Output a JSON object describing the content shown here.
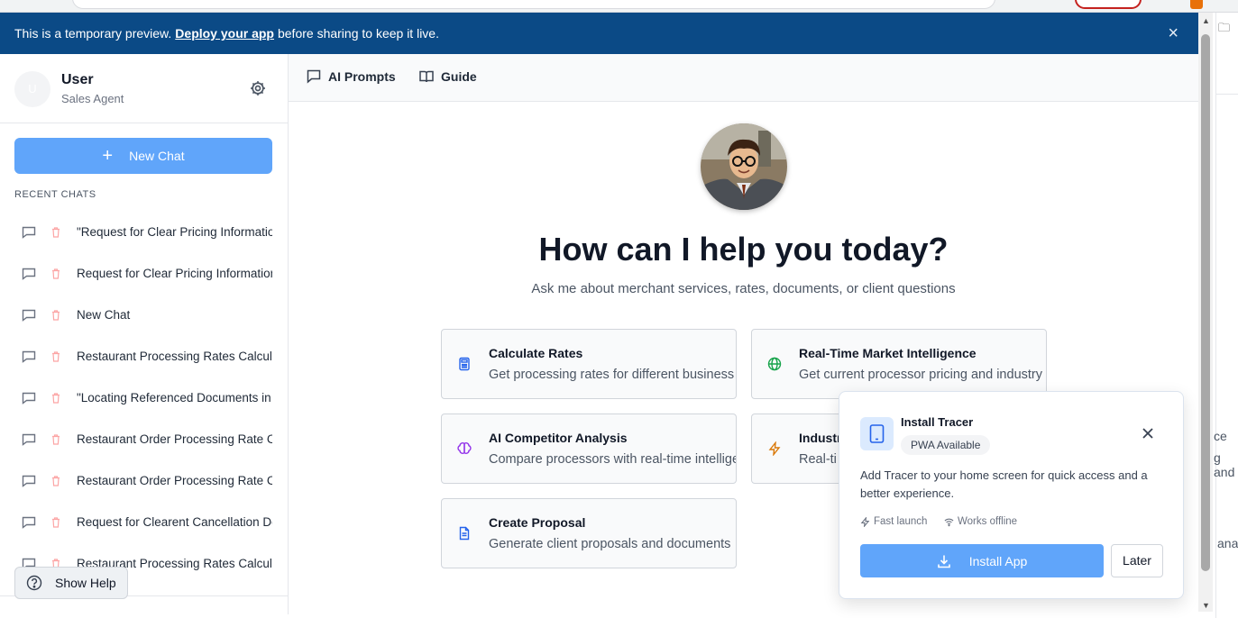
{
  "banner": {
    "text_before": "This is a temporary preview.",
    "link": "Deploy your app",
    "text_after": "before sharing to keep it live.",
    "close_icon": "close-icon"
  },
  "profile": {
    "avatar_initial": "U",
    "name": "User",
    "role": "Sales Agent",
    "settings_icon": "gear-icon"
  },
  "sidebar": {
    "new_chat_label": "New Chat",
    "recent_title": "RECENT CHATS",
    "chats": [
      "\"Request for Clear Pricing Information\"",
      "Request for Clear Pricing Information",
      "New Chat",
      "Restaurant Processing Rates Calculation",
      "\"Locating Referenced Documents in",
      "Restaurant Order Processing Rate Calculation",
      "Restaurant Order Processing Rate Calculation",
      "Request for Clearent Cancellation Document",
      "Restaurant Processing Rates Calculation"
    ],
    "show_help_label": "Show Help"
  },
  "topnav": {
    "ai_prompts": "AI Prompts",
    "guide": "Guide"
  },
  "hero": {
    "title": "How can I help you today?",
    "subtitle": "Ask me about merchant services, rates, documents, or client questions"
  },
  "cards": [
    {
      "title": "Calculate Rates",
      "desc": "Get processing rates for different business types",
      "icon": "calculator-icon",
      "color": "#2563eb"
    },
    {
      "title": "Real-Time Market Intelligence",
      "desc": "Get current processor pricing and industry trends",
      "icon": "globe-icon",
      "color": "#16a34a"
    },
    {
      "title": "AI Competitor Analysis",
      "desc": "Compare processors with real-time intelligence",
      "icon": "brain-icon",
      "color": "#9333ea"
    },
    {
      "title": "Industry",
      "desc": "Real-ti",
      "icon": "lightning-icon",
      "color": "#d97706"
    },
    {
      "title": "Create Proposal",
      "desc": "Generate client proposals and documents",
      "icon": "document-icon",
      "color": "#2563eb"
    }
  ],
  "install": {
    "title": "Install Tracer",
    "badge": "PWA Available",
    "description": "Add Tracer to your home screen for quick access and a better experience.",
    "feature_1": "Fast launch",
    "feature_2": "Works offline",
    "install_label": "Install App",
    "later_label": "Later"
  },
  "background_fragments": {
    "frag_1": "ce",
    "frag_2": "g and",
    "frag_3": "ana"
  },
  "colors": {
    "banner": "#0b4a86",
    "primary_button": "#60a5fa"
  }
}
